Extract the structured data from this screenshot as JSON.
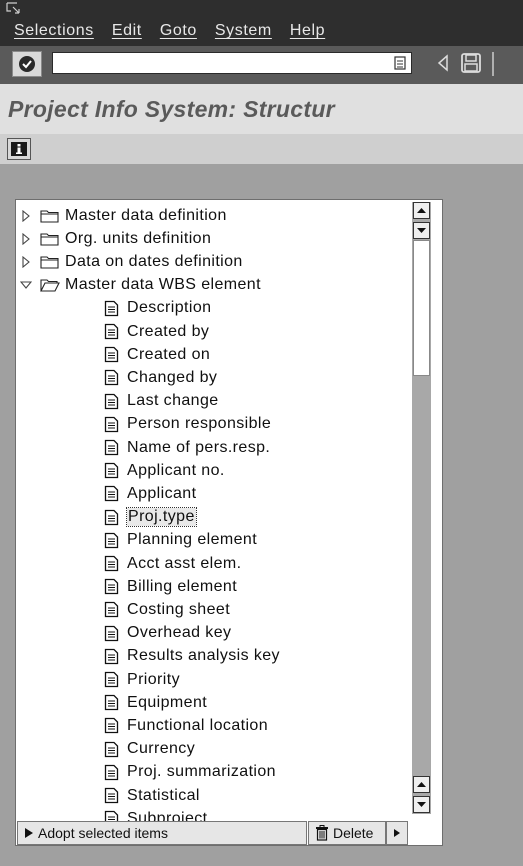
{
  "menu": {
    "items": [
      "Selections",
      "Edit",
      "Goto",
      "System",
      "Help"
    ]
  },
  "toolbar": {
    "command_value": "",
    "icons": [
      "enter-icon",
      "dropdown-icon",
      "back-icon",
      "save-icon"
    ]
  },
  "page": {
    "title": "Project Info System: Structur"
  },
  "app_toolbar": {
    "info_icon": "info-icon"
  },
  "tree": {
    "folders": [
      {
        "label": "Master data definition",
        "expanded": false
      },
      {
        "label": "Org. units definition",
        "expanded": false
      },
      {
        "label": "Data on dates definition",
        "expanded": false
      },
      {
        "label": "Master data WBS element",
        "expanded": true
      }
    ],
    "fields": [
      "Description",
      "Created by",
      "Created on",
      "Changed by",
      "Last change",
      "Person responsible",
      "Name of pers.resp.",
      "Applicant no.",
      "Applicant",
      "Proj.type",
      "Planning element",
      "Acct asst elem.",
      "Billing element",
      "Costing sheet",
      "Overhead key",
      "Results analysis key",
      "Priority",
      "Equipment",
      "Functional location",
      "Currency",
      "Proj. summarization",
      "Statistical",
      "Subproject"
    ],
    "selected_field": "Proj.type"
  },
  "buttons": {
    "adopt_label": "Adopt selected items",
    "delete_label": "Delete"
  },
  "colors": {
    "menubar": "#2e2e2e",
    "toolbar": "#5a5a5a",
    "workarea": "#a0a0a0",
    "title_text": "#5a5a5a"
  }
}
